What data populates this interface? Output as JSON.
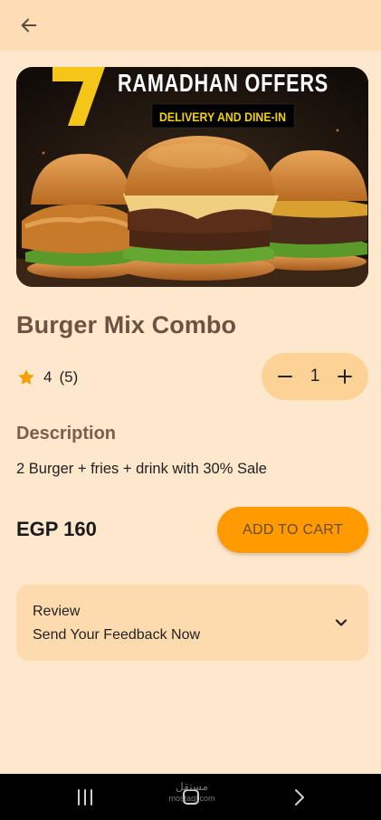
{
  "appbar": {
    "back_icon": "arrow-left-icon"
  },
  "hero": {
    "headline": "RAMADHAN OFFERS",
    "big_number": "7",
    "subline": "DELIVERY AND DINE-IN"
  },
  "product": {
    "title": "Burger Mix Combo",
    "rating_value": "4",
    "rating_count": "(5)",
    "rating_icon": "star-icon",
    "quantity": "1",
    "description_heading": "Description",
    "description": "2 Burger + fries + drink with 30% Sale",
    "price": "EGP 160",
    "add_to_cart_label": "ADD TO CART"
  },
  "review": {
    "label": "Review",
    "cta": "Send Your Feedback Now",
    "icon": "chevron-down-icon"
  },
  "system_nav": {
    "watermark_ar": "مستقل",
    "watermark_en": "mostaql.com"
  },
  "colors": {
    "background": "#FDE7CD",
    "appbar": "#FDDDB6",
    "accent": "#FF9A00",
    "stepper": "#FDD296",
    "title": "#6d5242",
    "star": "#F2A100"
  }
}
